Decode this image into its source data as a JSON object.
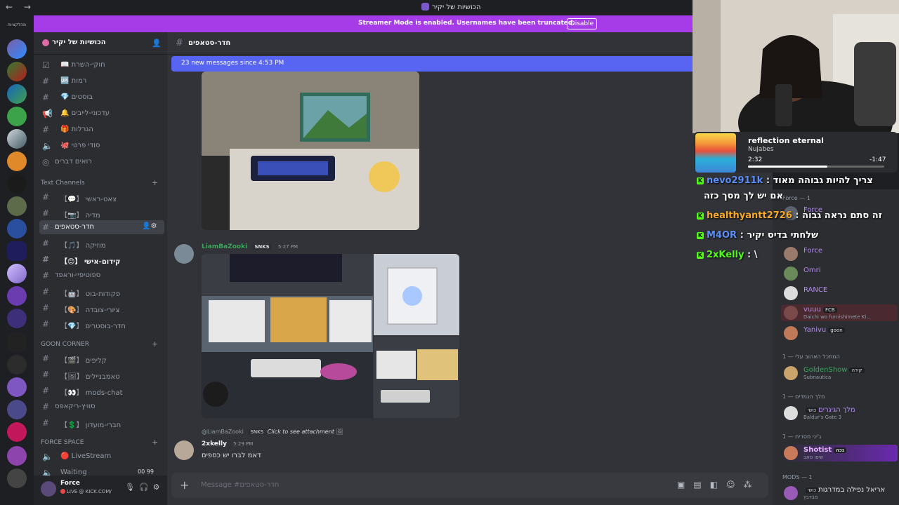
{
  "window": {
    "title": "הכושיות של יקיר",
    "nav": "← →"
  },
  "rail": {
    "label": "מהלקציות"
  },
  "banner": {
    "text": "Streamer Mode is enabled. Usernames have been truncated.",
    "button": "Disable"
  },
  "server": {
    "name": "הכושיות של יקיר"
  },
  "channels_top": [
    {
      "label": "חוקי-השרת",
      "emoji": "📖"
    },
    {
      "label": "רמות",
      "emoji": "🆙"
    },
    {
      "label": "בוסטים",
      "emoji": "💎"
    },
    {
      "label": "עדכוני-לייבים",
      "emoji": "🔔"
    },
    {
      "label": "הגרלות",
      "emoji": "🎁"
    },
    {
      "label": "סודי פרטי",
      "emoji": "🐙"
    },
    {
      "label": "רואים דברים",
      "emoji": ""
    }
  ],
  "categories": {
    "text": "Text Channels",
    "goon": "GOON CORNER",
    "force": "FORCE SPACE"
  },
  "text_channels": [
    {
      "label": "צאט-ראשי",
      "emoji": "【💬】"
    },
    {
      "label": "מדיה",
      "emoji": "【📷】"
    },
    {
      "label": "חדר-סטאפים",
      "emoji": ""
    },
    {
      "label": "מוזיקה",
      "emoji": "【🎵】"
    },
    {
      "label": "קידום-אישי",
      "emoji": "【😊】"
    },
    {
      "label": "ספוטיפיי-וראפד",
      "emoji": ""
    },
    {
      "label": "פקודות-בוט",
      "emoji": "【🤖】"
    },
    {
      "label": "ציורי-צובדה",
      "emoji": "【🎨】"
    },
    {
      "label": "חדר-בוסטרים",
      "emoji": "【💎】"
    }
  ],
  "goon_channels": [
    {
      "label": "קליפים",
      "emoji": "【🎬】"
    },
    {
      "label": "טאמבניילים",
      "emoji": "【🖼】"
    },
    {
      "label": "mods-chat",
      "emoji": "【👀】"
    },
    {
      "label": "סוויץ-ריקאפס",
      "emoji": ""
    },
    {
      "label": "חברי-מועדון",
      "emoji": "【💲】"
    }
  ],
  "force_channels": [
    {
      "label": "LiveStream",
      "emoji": "🔴"
    },
    {
      "label": "Waiting",
      "emoji": "",
      "counts": "00 99"
    }
  ],
  "user": {
    "name": "Force",
    "status": "LIVE @ KICK.COM/"
  },
  "main": {
    "channel": "חדר-סטאפים",
    "new_messages": "23 new messages since 4:53 PM",
    "composer_placeholder": "Message #חדר-סטאפים"
  },
  "messages": [
    {
      "author": "LiamBaZooki",
      "badge": "SNKS",
      "time": "5:27 PM",
      "color": "#3ba55d"
    },
    {
      "reply_author": "@LiamBaZooki",
      "reply_badge": "SNKS",
      "reply_text": "Click to see attachment",
      "author": "2xkelly",
      "time": "5:29 PM",
      "text": "דאמ לברו יש כספים"
    }
  ],
  "members": {
    "groups": [
      "Force — 1",
      "המתכל האהוב עלי — 1",
      "מלך הגמדים — 1",
      "ג'יגי מסריח — 1",
      "MODS — 1"
    ],
    "list": [
      {
        "name": "Force",
        "color": "#b38bf0",
        "tag": ""
      },
      {
        "name": "Force",
        "color": "#b38bf0",
        "tag": ""
      },
      {
        "name": "Omri",
        "color": "#b38bf0",
        "tag": ""
      },
      {
        "name": "RANCE",
        "color": "#b38bf0",
        "tag": ""
      },
      {
        "name": "vuuu",
        "color": "#b38bf0",
        "tag": "FCB",
        "sub": "Daichi wo furnishimete Ki..."
      },
      {
        "name": "Yanivu",
        "color": "#b38bf0",
        "tag": "goon"
      },
      {
        "name": "GoldenShow",
        "color": "#3ba55d",
        "tag": "קירה",
        "sub": "Subnautica"
      },
      {
        "name": "מלך הגיגרים",
        "color": "#b38bf0",
        "tag": "כושי",
        "sub": "Baldur's Gate 3"
      },
      {
        "name": "Shotist",
        "color": "#e8b4ff",
        "tag": "נכה",
        "sub": "שיפו סאב"
      },
      {
        "name": "אריאל נפילה במדרגות",
        "color": "#e8e8e8",
        "tag": "כושי",
        "sub": "מבדבץ"
      }
    ]
  },
  "now_playing": {
    "song": "reflection eternal",
    "artist": "Nujabes",
    "elapsed": "2:32",
    "remaining": "-1:47",
    "progress": 0.58
  },
  "chat_overlay": [
    {
      "user": "",
      "text": "צריך להיות גבוהה מאוד",
      "prefix": "nevo2911k",
      "color": "#5b8ff9"
    },
    {
      "user": "",
      "text": "אם יש לך מסך כזה",
      "prefix": "",
      "color": "#ffffff"
    },
    {
      "user": "healthyantt2726",
      "text": "זה סתם נראה גבוה",
      "color": "#f7a928"
    },
    {
      "user": "M4OR",
      "text": "שלחתי בדיס יקיר",
      "color": "#5b8ff9"
    },
    {
      "user": "2xKelly",
      "text": "\\",
      "color": "#53fc18"
    }
  ]
}
